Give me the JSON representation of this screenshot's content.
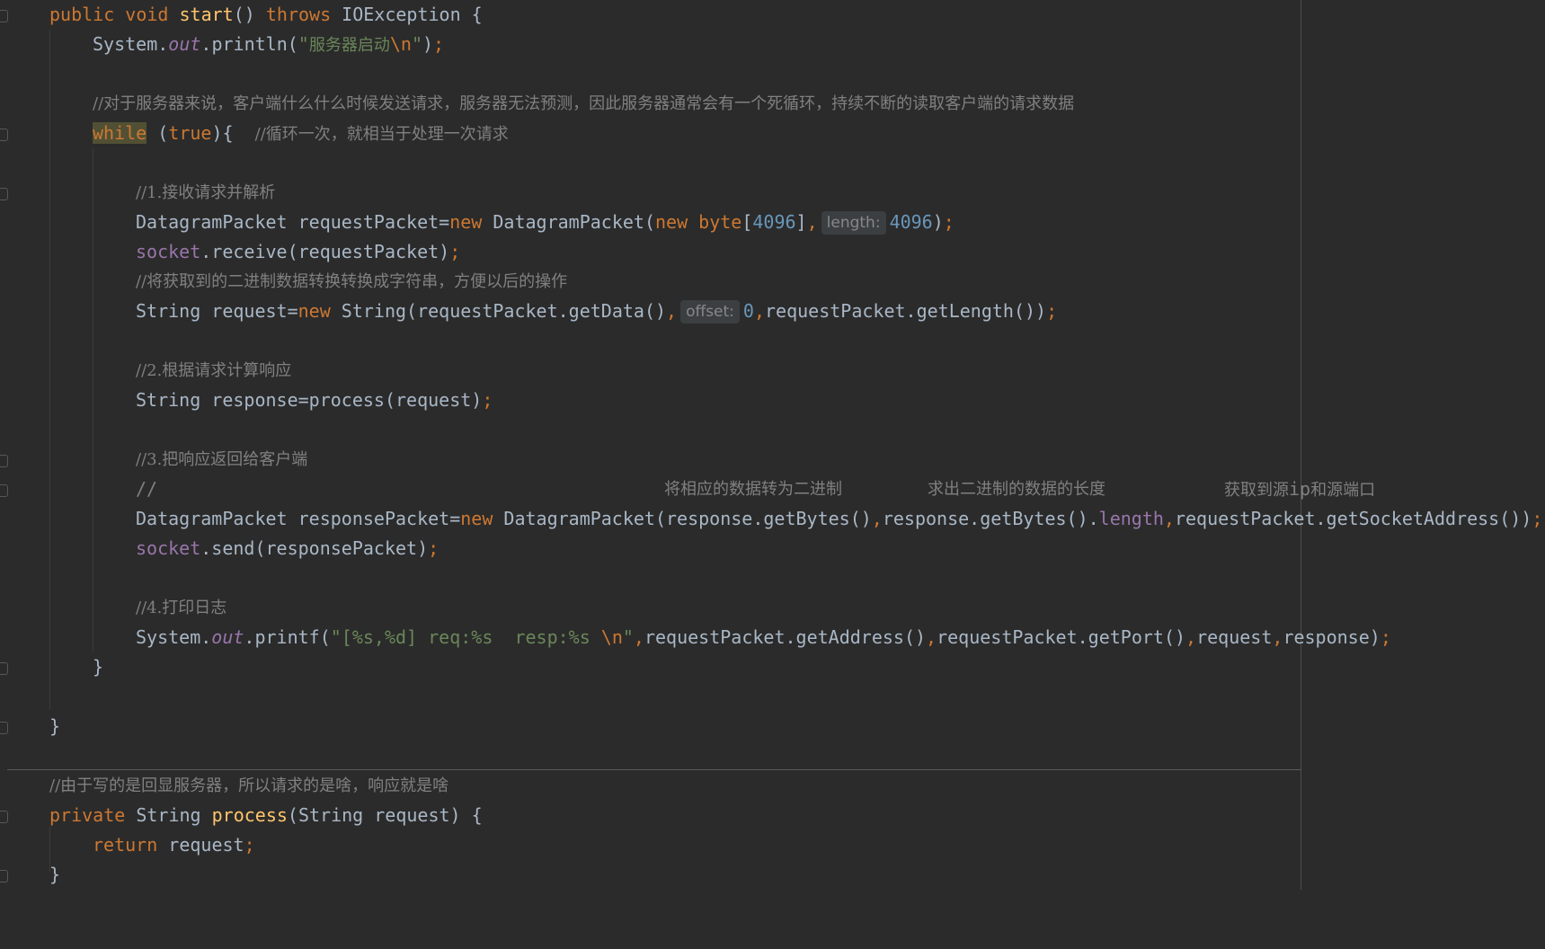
{
  "code": {
    "l1": {
      "public": "public",
      "void": "void",
      "start": "start",
      "parens": "()",
      "throws": "throws",
      "exc": "IOException {"
    },
    "l2": {
      "sys": "System.",
      "out": "out",
      "println": ".println(",
      "q1": "\"",
      "str": "服务器启动",
      "esc": "\\n",
      "q2": "\"",
      "close": ")",
      "semi": ";"
    },
    "l3": {
      "comment": "//对于服务器来说，客户端什么什么时候发送请求，服务器无法预测，因此服务器通常会有一个死循环，持续不断的读取客户端的请求数据"
    },
    "l4": {
      "while": "while",
      "space": " (",
      "true": "true",
      "rest": "){  ",
      "comment": "//循环一次，就相当于处理一次请求"
    },
    "l5": {
      "comment": "//1.接收请求并解析"
    },
    "l6": {
      "a": "DatagramPacket requestPacket=",
      "new1": "new",
      "b": " DatagramPacket(",
      "new2": "new",
      "byte": " byte",
      "lb": "[",
      "n1": "4096",
      "rb": "]",
      "comma": ",",
      "hint": "length:",
      "n2": "4096",
      "close": ")",
      "semi": ";"
    },
    "l7": {
      "socket": "socket",
      "rest": ".receive(requestPacket)",
      "semi": ";"
    },
    "l8": {
      "comment": "//将获取到的二进制数据转换转换成字符串，方便以后的操作"
    },
    "l9": {
      "a": "String request=",
      "new": "new",
      "b": " String(requestPacket.getData()",
      "comma1": ",",
      "hint": "offset:",
      "zero": "0",
      "comma2": ",",
      "c": "requestPacket.getLength())",
      "semi": ";"
    },
    "l10": {
      "comment": "//2.根据请求计算响应"
    },
    "l11": {
      "a": "String response=process(request)",
      "semi": ";"
    },
    "l12": {
      "comment": "//3.把响应返回给客户端"
    },
    "l13": {
      "slashes": "//",
      "c1": "将相应的数据转为二进制",
      "c2": "求出二进制的数据的长度",
      "c3": "获取到源",
      "ip": "ip",
      "c4": "和源端口"
    },
    "l14": {
      "a": "DatagramPacket responsePacket=",
      "new": "new",
      "b": " DatagramPacket(response.getBytes()",
      "c1": ",",
      "c": "response.getBytes().",
      "length": "length",
      "c2": ",",
      "d": "requestPacket.getSocketAddress())",
      "semi": ";"
    },
    "l15": {
      "socket": "socket",
      "rest": ".send(responsePacket)",
      "semi": ";"
    },
    "l16": {
      "comment": "//4.打印日志"
    },
    "l17": {
      "sys": "System.",
      "out": "out",
      "printf": ".printf(",
      "str1": "\"[%s,%d] req:%s  resp:%s ",
      "esc": "\\n",
      "q": "\"",
      "c1": ",",
      "a": "requestPacket.getAddress()",
      "c2": ",",
      "b": "requestPacket.getPort()",
      "c3": ",",
      "c": "request",
      "c4": ",",
      "d": "response)",
      "semi": ";"
    },
    "l18": {
      "brace": "}"
    },
    "l19": {
      "brace": "}"
    },
    "l20": {
      "comment": "//由于写的是回显服务器，所以请求的是啥，响应就是啥"
    },
    "l21": {
      "private": "private",
      "a": " String ",
      "process": "process",
      "b": "(String request) {"
    },
    "l22": {
      "return": "return",
      "a": " request",
      "semi": ";"
    },
    "l23": {
      "brace": "}"
    }
  },
  "colors": {
    "background": "#2b2b2b",
    "keyword": "#cc7832",
    "method": "#ffc66d",
    "string": "#6a8759",
    "number": "#6897bb",
    "comment": "#808080",
    "field": "#9876aa",
    "text": "#a9b7c6"
  }
}
